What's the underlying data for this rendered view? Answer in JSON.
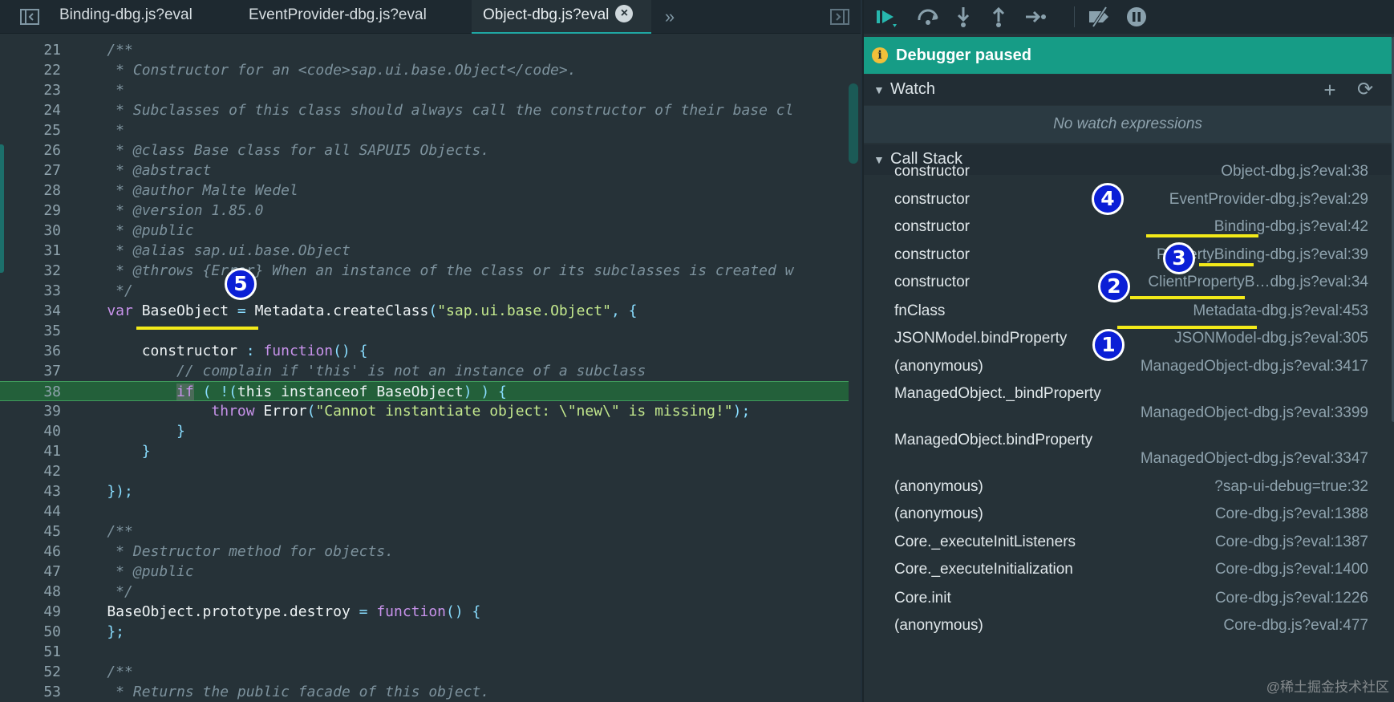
{
  "tabs": [
    {
      "label": "Binding-dbg.js?eval",
      "active": false
    },
    {
      "label": "EventProvider-dbg.js?eval",
      "active": false
    },
    {
      "label": "Object-dbg.js?eval",
      "active": true
    }
  ],
  "tab_icons": {
    "toggle_sidebar": "sidebar-toggle-icon",
    "more": "chevrons-right-icon",
    "panel": "panel-toggle-icon",
    "close": "close-icon"
  },
  "editor": {
    "paused_line": "38",
    "lines": [
      {
        "n": "21",
        "tokens": [
          [
            "com",
            "    /**"
          ]
        ]
      },
      {
        "n": "22",
        "tokens": [
          [
            "com",
            "     * Constructor for an <code>sap.ui.base.Object</code>."
          ]
        ]
      },
      {
        "n": "23",
        "tokens": [
          [
            "com",
            "     *"
          ]
        ]
      },
      {
        "n": "24",
        "tokens": [
          [
            "com",
            "     * Subclasses of this class should always call the constructor of their base cl"
          ]
        ]
      },
      {
        "n": "25",
        "tokens": [
          [
            "com",
            "     *"
          ]
        ]
      },
      {
        "n": "26",
        "tokens": [
          [
            "com",
            "     * @class Base class for all SAPUI5 Objects."
          ]
        ]
      },
      {
        "n": "27",
        "tokens": [
          [
            "com",
            "     * @abstract"
          ]
        ]
      },
      {
        "n": "28",
        "tokens": [
          [
            "com",
            "     * @author Malte Wedel"
          ]
        ]
      },
      {
        "n": "29",
        "tokens": [
          [
            "com",
            "     * @version 1.85.0"
          ]
        ]
      },
      {
        "n": "30",
        "tokens": [
          [
            "com",
            "     * @public"
          ]
        ]
      },
      {
        "n": "31",
        "tokens": [
          [
            "com",
            "     * @alias sap.ui.base.Object"
          ]
        ]
      },
      {
        "n": "32",
        "tokens": [
          [
            "com",
            "     * @throws {Error} When an instance of the class or its subclasses is created w"
          ]
        ]
      },
      {
        "n": "33",
        "tokens": [
          [
            "com",
            "     */"
          ]
        ]
      },
      {
        "n": "34",
        "tokens": [
          [
            "kw",
            "    var "
          ],
          [
            "id",
            "BaseObject"
          ],
          [
            "pun",
            " = "
          ],
          [
            "id",
            "Metadata.createClass"
          ],
          [
            "pun",
            "("
          ],
          [
            "str",
            "\"sap.ui.base.Object\""
          ],
          [
            "pun",
            ", {"
          ]
        ]
      },
      {
        "n": "35",
        "tokens": [
          [
            "id",
            ""
          ]
        ]
      },
      {
        "n": "36",
        "tokens": [
          [
            "id",
            "        constructor "
          ],
          [
            "pun",
            ": "
          ],
          [
            "kw",
            "function"
          ],
          [
            "pun",
            "() {"
          ]
        ]
      },
      {
        "n": "37",
        "tokens": [
          [
            "com",
            "            // complain if 'this' is not an instance of a subclass"
          ]
        ]
      },
      {
        "n": "38",
        "tokens": [
          [
            "id",
            "            "
          ],
          [
            "kwh",
            "if"
          ],
          [
            "pun",
            " ( !("
          ],
          [
            "id",
            "this instanceof BaseObject"
          ],
          [
            "pun",
            ") ) {"
          ]
        ]
      },
      {
        "n": "39",
        "tokens": [
          [
            "kw",
            "                throw "
          ],
          [
            "id",
            "Error"
          ],
          [
            "pun",
            "("
          ],
          [
            "str",
            "\"Cannot instantiate object: \\\"new\\\" is missing!\""
          ],
          [
            "pun",
            ");"
          ]
        ]
      },
      {
        "n": "40",
        "tokens": [
          [
            "pun",
            "            }"
          ]
        ]
      },
      {
        "n": "41",
        "tokens": [
          [
            "pun",
            "        }"
          ]
        ]
      },
      {
        "n": "42",
        "tokens": [
          [
            "id",
            ""
          ]
        ]
      },
      {
        "n": "43",
        "tokens": [
          [
            "pun",
            "    });"
          ]
        ]
      },
      {
        "n": "44",
        "tokens": [
          [
            "id",
            ""
          ]
        ]
      },
      {
        "n": "45",
        "tokens": [
          [
            "com",
            "    /**"
          ]
        ]
      },
      {
        "n": "46",
        "tokens": [
          [
            "com",
            "     * Destructor method for objects."
          ]
        ]
      },
      {
        "n": "47",
        "tokens": [
          [
            "com",
            "     * @public"
          ]
        ]
      },
      {
        "n": "48",
        "tokens": [
          [
            "com",
            "     */"
          ]
        ]
      },
      {
        "n": "49",
        "tokens": [
          [
            "id",
            "    BaseObject.prototype.destroy "
          ],
          [
            "pun",
            "= "
          ],
          [
            "kw",
            "function"
          ],
          [
            "pun",
            "() {"
          ]
        ]
      },
      {
        "n": "50",
        "tokens": [
          [
            "pun",
            "    };"
          ]
        ]
      },
      {
        "n": "51",
        "tokens": [
          [
            "id",
            ""
          ]
        ]
      },
      {
        "n": "52",
        "tokens": [
          [
            "com",
            "    /**"
          ]
        ]
      },
      {
        "n": "53",
        "tokens": [
          [
            "com",
            "     * Returns the public facade of this object."
          ]
        ]
      }
    ]
  },
  "debugger": {
    "toolbar_icons": [
      "resume-icon",
      "step-over-icon",
      "step-into-icon",
      "step-out-icon",
      "step-icon",
      "deactivate-breakpoints-icon",
      "pause-on-exceptions-icon"
    ],
    "status": "Debugger paused",
    "watch": {
      "title": "Watch",
      "empty": "No watch expressions",
      "icons": [
        "add-icon",
        "refresh-icon"
      ]
    },
    "callstack": {
      "title": "Call Stack",
      "frames": [
        {
          "name": "constructor",
          "loc": "Object-dbg.js?eval:38"
        },
        {
          "name": "constructor",
          "loc": "EventProvider-dbg.js?eval:29"
        },
        {
          "name": "constructor",
          "loc": "Binding-dbg.js?eval:42"
        },
        {
          "name": "constructor",
          "loc": "PropertyBinding-dbg.js?eval:39"
        },
        {
          "name": "constructor",
          "loc": "ClientPropertyB…dbg.js?eval:34"
        },
        {
          "name": "fnClass",
          "loc": "Metadata-dbg.js?eval:453"
        },
        {
          "name": "JSONModel.bindProperty",
          "loc": "JSONModel-dbg.js?eval:305"
        },
        {
          "name": "(anonymous)",
          "loc": "ManagedObject-dbg.js?eval:3417"
        },
        {
          "name": "ManagedObject._bindProperty",
          "loc": "ManagedObject-dbg.js?eval:3399"
        },
        {
          "name": "ManagedObject.bindProperty",
          "loc": "ManagedObject-dbg.js?eval:3347"
        },
        {
          "name": "(anonymous)",
          "loc": "?sap-ui-debug=true:32"
        },
        {
          "name": "(anonymous)",
          "loc": "Core-dbg.js?eval:1388"
        },
        {
          "name": "Core._executeInitListeners",
          "loc": "Core-dbg.js?eval:1387"
        },
        {
          "name": "Core._executeInitialization",
          "loc": "Core-dbg.js?eval:1400"
        },
        {
          "name": "Core.init",
          "loc": "Core-dbg.js?eval:1226"
        },
        {
          "name": "(anonymous)",
          "loc": "Core-dbg.js?eval:477"
        }
      ]
    }
  },
  "annotations": [
    "1",
    "2",
    "3",
    "4",
    "5"
  ],
  "watermark": "@稀土掘金技术社区",
  "colors": {
    "badge": "#0b1fd6",
    "underline": "#f3ea19",
    "paused_bar": "#169c86",
    "paused_line": "#23603a"
  }
}
